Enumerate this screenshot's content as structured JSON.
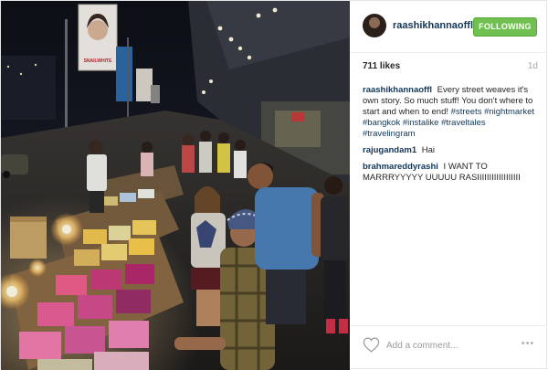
{
  "post": {
    "username": "raashikhannaoffl",
    "follow_label": "FOLLOWING",
    "likes": "711 likes",
    "time_ago": "1d",
    "caption": {
      "user": "raashikhannaoffl",
      "text": "Every street weaves it's own story. So much stuff! You don't where to start and when to end!",
      "hashtags": [
        "#streets",
        "#nightmarket",
        "#bangkok",
        "#instalike",
        "#traveltales",
        "#travelingram"
      ]
    },
    "comments": [
      {
        "user": "rajugandam1",
        "text": "Hai"
      },
      {
        "user": "brahmareddyrashi",
        "text": "I WANT TO MARRRYYYYY UUUUU RASIIIIIIIIIIIIIIIIII"
      }
    ],
    "add_comment_placeholder": "Add a comment...",
    "more_label": "•••"
  },
  "photo": {
    "billboard_text": "SNAILWHITE",
    "icons": {
      "like": "heart-icon",
      "more": "more-options-icon"
    }
  },
  "colors": {
    "follow_green": "#70c050",
    "username_blue": "#12375a",
    "muted_gray": "#a5a7aa"
  }
}
